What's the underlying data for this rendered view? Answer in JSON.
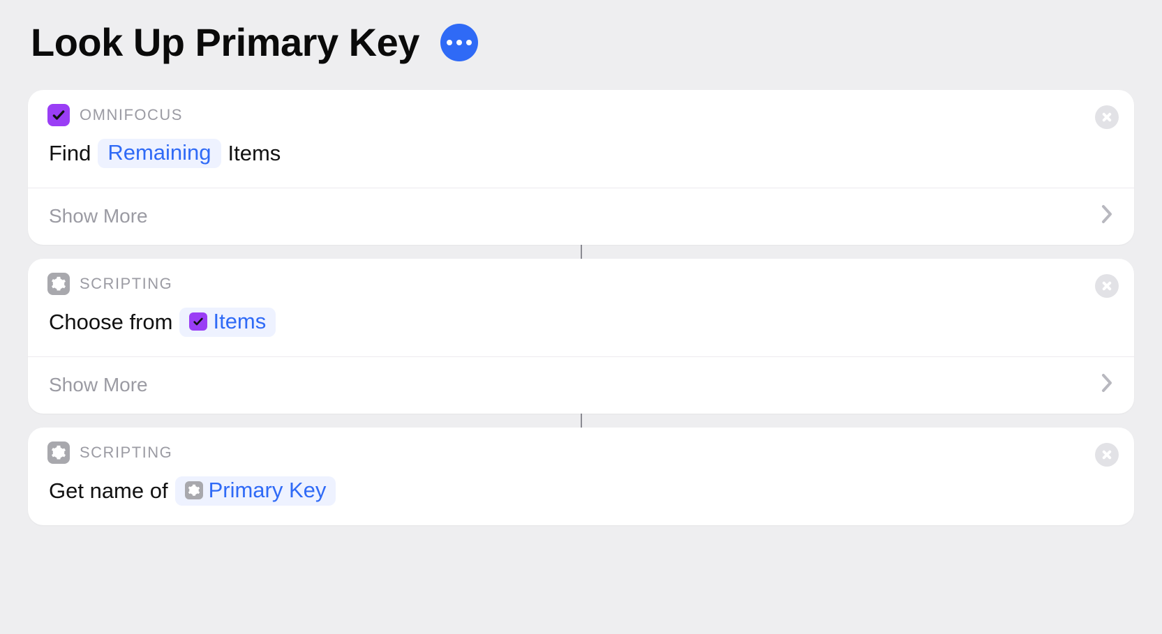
{
  "title": "Look Up Primary Key",
  "cards": [
    {
      "app_name": "OMNIFOCUS",
      "action": {
        "prefix": "Find",
        "token_label": "Remaining",
        "suffix": "Items"
      },
      "show_more": "Show More"
    },
    {
      "app_name": "SCRIPTING",
      "action": {
        "prefix": "Choose from",
        "token_label": "Items",
        "suffix": ""
      },
      "show_more": "Show More"
    },
    {
      "app_name": "SCRIPTING",
      "action": {
        "prefix": "Get name of",
        "token_label": "Primary Key",
        "suffix": ""
      }
    }
  ]
}
